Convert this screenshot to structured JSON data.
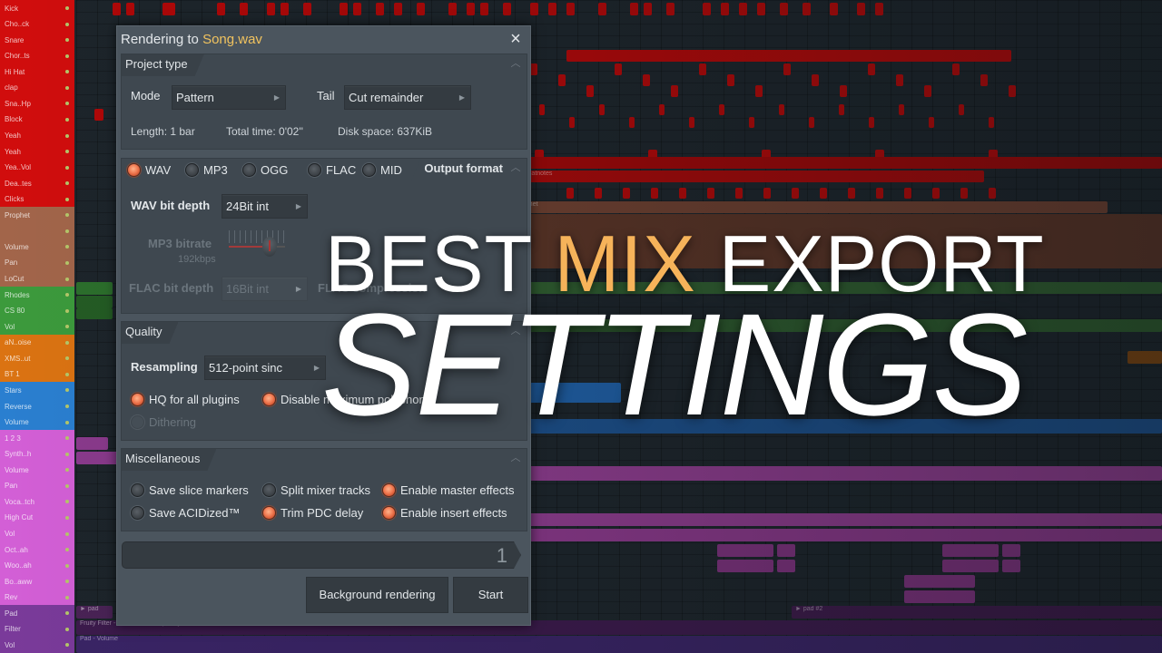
{
  "playlist": {
    "tracks": [
      {
        "label": "Kick",
        "color": "#d10d0d"
      },
      {
        "label": "Cho..ck",
        "color": "#d10d0d"
      },
      {
        "label": "Snare",
        "color": "#d10d0d"
      },
      {
        "label": "Chor..ts",
        "color": "#d10d0d"
      },
      {
        "label": "Hi Hat",
        "color": "#d10d0d"
      },
      {
        "label": "clap",
        "color": "#d10d0d"
      },
      {
        "label": "Sna..Hp",
        "color": "#d10d0d"
      },
      {
        "label": "Block",
        "color": "#d10d0d"
      },
      {
        "label": "Yeah",
        "color": "#d10d0d"
      },
      {
        "label": "Yeah",
        "color": "#d10d0d"
      },
      {
        "label": "Yea..Vol",
        "color": "#d10d0d"
      },
      {
        "label": "Dea..tes",
        "color": "#d10d0d"
      },
      {
        "label": "Clicks",
        "color": "#d10d0d"
      },
      {
        "label": "Prophet",
        "color": "#a2654a"
      },
      {
        "label": "",
        "color": "#a2654a"
      },
      {
        "label": "Volume",
        "color": "#a2654a"
      },
      {
        "label": "Pan",
        "color": "#a2654a"
      },
      {
        "label": "LoCut",
        "color": "#a2654a"
      },
      {
        "label": "Rhodes",
        "color": "#3c9a3c"
      },
      {
        "label": "CS 80",
        "color": "#3c9a3c"
      },
      {
        "label": "Vol",
        "color": "#3c9a3c"
      },
      {
        "label": "aN..oise",
        "color": "#db7312"
      },
      {
        "label": "XMS..ut",
        "color": "#db7312"
      },
      {
        "label": "BT 1",
        "color": "#db7312"
      },
      {
        "label": "Stars",
        "color": "#2a7fd0"
      },
      {
        "label": "Reverse",
        "color": "#2a7fd0"
      },
      {
        "label": "Volume",
        "color": "#2a7fd0"
      },
      {
        "label": "1 2 3",
        "color": "#d35fd6"
      },
      {
        "label": "Synth..h",
        "color": "#d35fd6"
      },
      {
        "label": "Volume",
        "color": "#d35fd6"
      },
      {
        "label": "Pan",
        "color": "#d35fd6"
      },
      {
        "label": "Voca..tch",
        "color": "#d35fd6"
      },
      {
        "label": "High Cut",
        "color": "#d35fd6"
      },
      {
        "label": "Vol",
        "color": "#d35fd6"
      },
      {
        "label": "Oct..ah",
        "color": "#d35fd6"
      },
      {
        "label": "Woo..ah",
        "color": "#d35fd6"
      },
      {
        "label": "Bo..aww",
        "color": "#d35fd6"
      },
      {
        "label": "Rev",
        "color": "#d35fd6"
      },
      {
        "label": "Pad",
        "color": "#7a3a9a"
      },
      {
        "label": "Filter",
        "color": "#7a3a9a"
      },
      {
        "label": "Vol",
        "color": "#7a3a9a"
      }
    ],
    "clip_labels": {
      "beatnotes": "► Beatnotes",
      "prophet": "Prophet",
      "pad": "► pad",
      "pad2": "► pad #2",
      "filter_auto": "Fruity Filter - Pad - Cutoff frequency",
      "pad_vol": "Pad - Volume"
    }
  },
  "dialog": {
    "title_prefix": "Rendering to ",
    "title_file": "Song.wav",
    "close_icon": "×",
    "project_type": {
      "heading": "Project type",
      "mode_label": "Mode",
      "mode_value": "Pattern",
      "tail_label": "Tail",
      "tail_value": "Cut remainder",
      "length": "Length: 1 bar",
      "total_time": "Total time: 0'02''",
      "disk_space": "Disk space: 637KiB"
    },
    "output_format": {
      "heading": "Output format",
      "formats": [
        {
          "label": "WAV",
          "selected": true
        },
        {
          "label": "MP3",
          "selected": false
        },
        {
          "label": "OGG",
          "selected": false
        },
        {
          "label": "FLAC",
          "selected": false
        },
        {
          "label": "MID",
          "selected": false
        }
      ],
      "wav_bit_depth_label": "WAV bit depth",
      "wav_bit_depth_value": "24Bit int",
      "mp3_bitrate_label": "MP3 bitrate",
      "mp3_bitrate_value": "192kbps",
      "mp3_bitrate_fraction": 0.72,
      "flac_bit_depth_label": "FLAC bit depth",
      "flac_bit_depth_value": "16Bit int",
      "flac_compression_label": "FLAC compression"
    },
    "quality": {
      "heading": "Quality",
      "resampling_label": "Resampling",
      "resampling_value": "512-point sinc",
      "hq_plugins": {
        "label": "HQ for all plugins",
        "checked": true
      },
      "disable_polyphony": {
        "label": "Disable maximum polyphony",
        "checked": true
      },
      "dithering": {
        "label": "Dithering",
        "checked": false
      }
    },
    "misc": {
      "heading": "Miscellaneous",
      "save_slice_markers": {
        "label": "Save slice markers",
        "checked": false
      },
      "split_mixer_tracks": {
        "label": "Split mixer tracks",
        "checked": false
      },
      "enable_master_effects": {
        "label": "Enable master effects",
        "checked": true
      },
      "save_acidized": {
        "label": "Save ACIDized™",
        "checked": false
      },
      "trim_pdc_delay": {
        "label": "Trim PDC delay",
        "checked": true
      },
      "enable_insert_effects": {
        "label": "Enable insert effects",
        "checked": true
      }
    },
    "progress_value": "1",
    "background_rendering_label": "Background rendering",
    "start_label": "Start"
  },
  "headline": {
    "word1": "BEST ",
    "word2_accent": "MIX",
    "word3": " EXPORT",
    "line2": "SETTINGS",
    "accent_color": "#f6b35a"
  }
}
